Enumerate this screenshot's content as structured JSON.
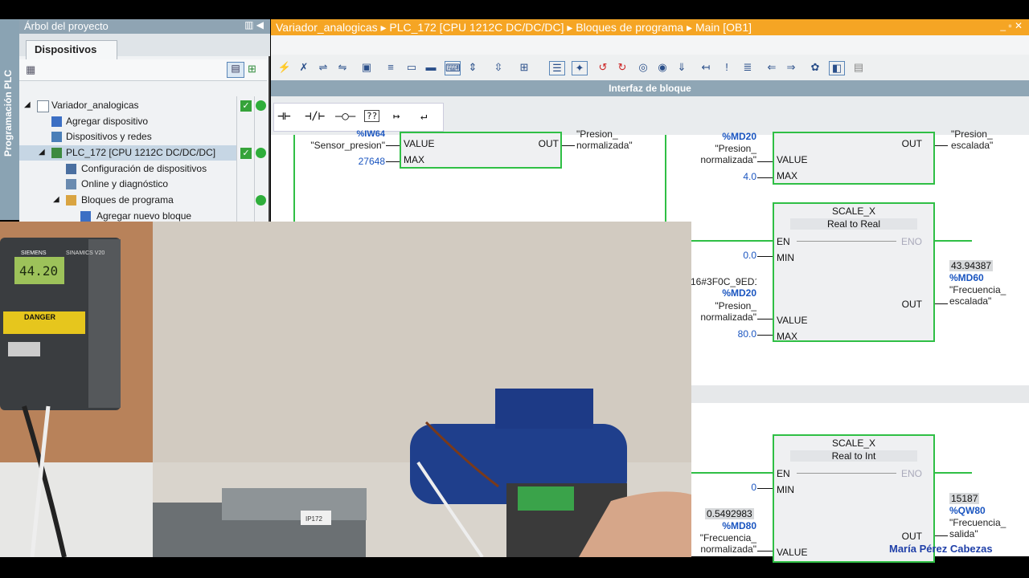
{
  "project_tree": {
    "vertical_tab": "Programación PLC",
    "title": "Árbol del proyecto",
    "tab": "Dispositivos",
    "items": [
      {
        "label": "Variador_analogicas"
      },
      {
        "label": "Agregar dispositivo"
      },
      {
        "label": "Dispositivos y redes"
      },
      {
        "label": "PLC_172 [CPU 1212C DC/DC/DC]"
      },
      {
        "label": "Configuración de dispositivos"
      },
      {
        "label": "Online y diagnóstico"
      },
      {
        "label": "Bloques de programa"
      },
      {
        "label": "Agregar nuevo bloque"
      }
    ]
  },
  "editor": {
    "breadcrumb": "Variador_analogicas  ▸  PLC_172 [CPU 1212C DC/DC/DC]  ▸  Bloques de programa  ▸  Main [OB1]",
    "window_controls": "_ ▫ ✕",
    "interface_bar": "Interfaz de bloque",
    "ladder_symbols": [
      "⊣⊢",
      "⊣/⊢",
      "–○–",
      "??",
      "↦",
      "↵"
    ]
  },
  "network1": {
    "left_block": {
      "in_top_addr": "%IW64",
      "value_tag": "\"Sensor_presion\"",
      "value_label": "VALUE",
      "max_value": "27648",
      "max_label": "MAX",
      "out_label": "OUT",
      "out_tag": "\"Presion_ normalizada\""
    },
    "right_block": {
      "value_addr": "%MD20",
      "value_tag": "\"Presion_ normalizada\"",
      "value_label": "VALUE",
      "max_value": "4.0",
      "max_label": "MAX",
      "out_label": "OUT",
      "out_tag": "\"Presion_ escalada\""
    }
  },
  "network2": {
    "title": "SCALE_X",
    "subtitle": "Real  to  Real",
    "en": "EN",
    "eno": "ENO",
    "min_value": "0.0",
    "min_label": "MIN",
    "value_monitor": "16#3F0C_9ED1",
    "value_addr": "%MD20",
    "value_tag": "\"Presion_ normalizada\"",
    "value_label": "VALUE",
    "max_value": "80.0",
    "max_label": "MAX",
    "out_label": "OUT",
    "out_monitor": "43.94387",
    "out_addr": "%MD60",
    "out_tag": "\"Frecuencia_ escalada\""
  },
  "network3": {
    "title": "SCALE_X",
    "subtitle": "Real  to  Int",
    "en": "EN",
    "eno": "ENO",
    "min_value": "0",
    "min_label": "MIN",
    "value_monitor": "0.5492983",
    "value_addr": "%MD80",
    "value_tag": "\"Frecuencia_ normalizada\"",
    "value_label": "VALUE",
    "out_label": "OUT",
    "out_monitor": "15187",
    "out_addr": "%QW80",
    "out_tag": "\"Frecuencia_ salida\""
  },
  "photo": {
    "drive_brand": "SIEMENS",
    "drive_model": "SINAMICS V20",
    "drive_display": "44.20",
    "plc_label": "IP172",
    "danger": "DANGER"
  },
  "credit": "María Pérez Cabezas",
  "colors": {
    "accent_orange": "#f5a524",
    "rung_green": "#2fbf45",
    "address_blue": "#1a55c0"
  }
}
